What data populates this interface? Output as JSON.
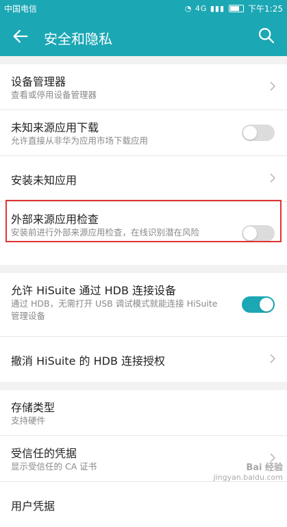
{
  "status_bar": {
    "carrier": "中国电信",
    "time": "下午1:25",
    "icons": "wifi · 4G · signal · battery"
  },
  "app_bar": {
    "title": "安全和隐私",
    "back_icon": "arrow-left-icon",
    "search_icon": "search-icon"
  },
  "groups": [
    {
      "items": [
        {
          "title": "设备管理器",
          "subtitle": "查看或停用设备管理器",
          "control": "chevron"
        },
        {
          "title": "未知来源应用下载",
          "subtitle": "允许直接从非华为应用市场下载应用",
          "control": "toggle",
          "toggle_on": false
        },
        {
          "title": "安装未知应用",
          "control": "chevron"
        },
        {
          "title": "外部来源应用检查",
          "subtitle": "安装前进行外部来源应用检查，在线识别潜在风险",
          "control": "toggle",
          "toggle_on": false,
          "highlighted": true
        }
      ]
    },
    {
      "items": [
        {
          "title": "允许 HiSuite 通过 HDB 连接设备",
          "subtitle": "通过 HDB，无需打开 USB 调试模式就能连接 HiSuite 管理设备",
          "control": "toggle",
          "toggle_on": true
        },
        {
          "title": "撤消 HiSuite 的 HDB 连接授权",
          "control": "chevron"
        }
      ]
    },
    {
      "items": [
        {
          "title": "存储类型",
          "subtitle": "支持硬件"
        },
        {
          "title": "受信任的凭据",
          "subtitle": "显示受信任的 CA 证书",
          "control": "chevron"
        },
        {
          "title": "用户凭据"
        }
      ]
    }
  ],
  "watermark": {
    "brand": "Bai 经验",
    "url": "jingyan.baidu.com"
  },
  "colors": {
    "accent": "#1ba7b4",
    "highlight_border": "#e03232"
  }
}
